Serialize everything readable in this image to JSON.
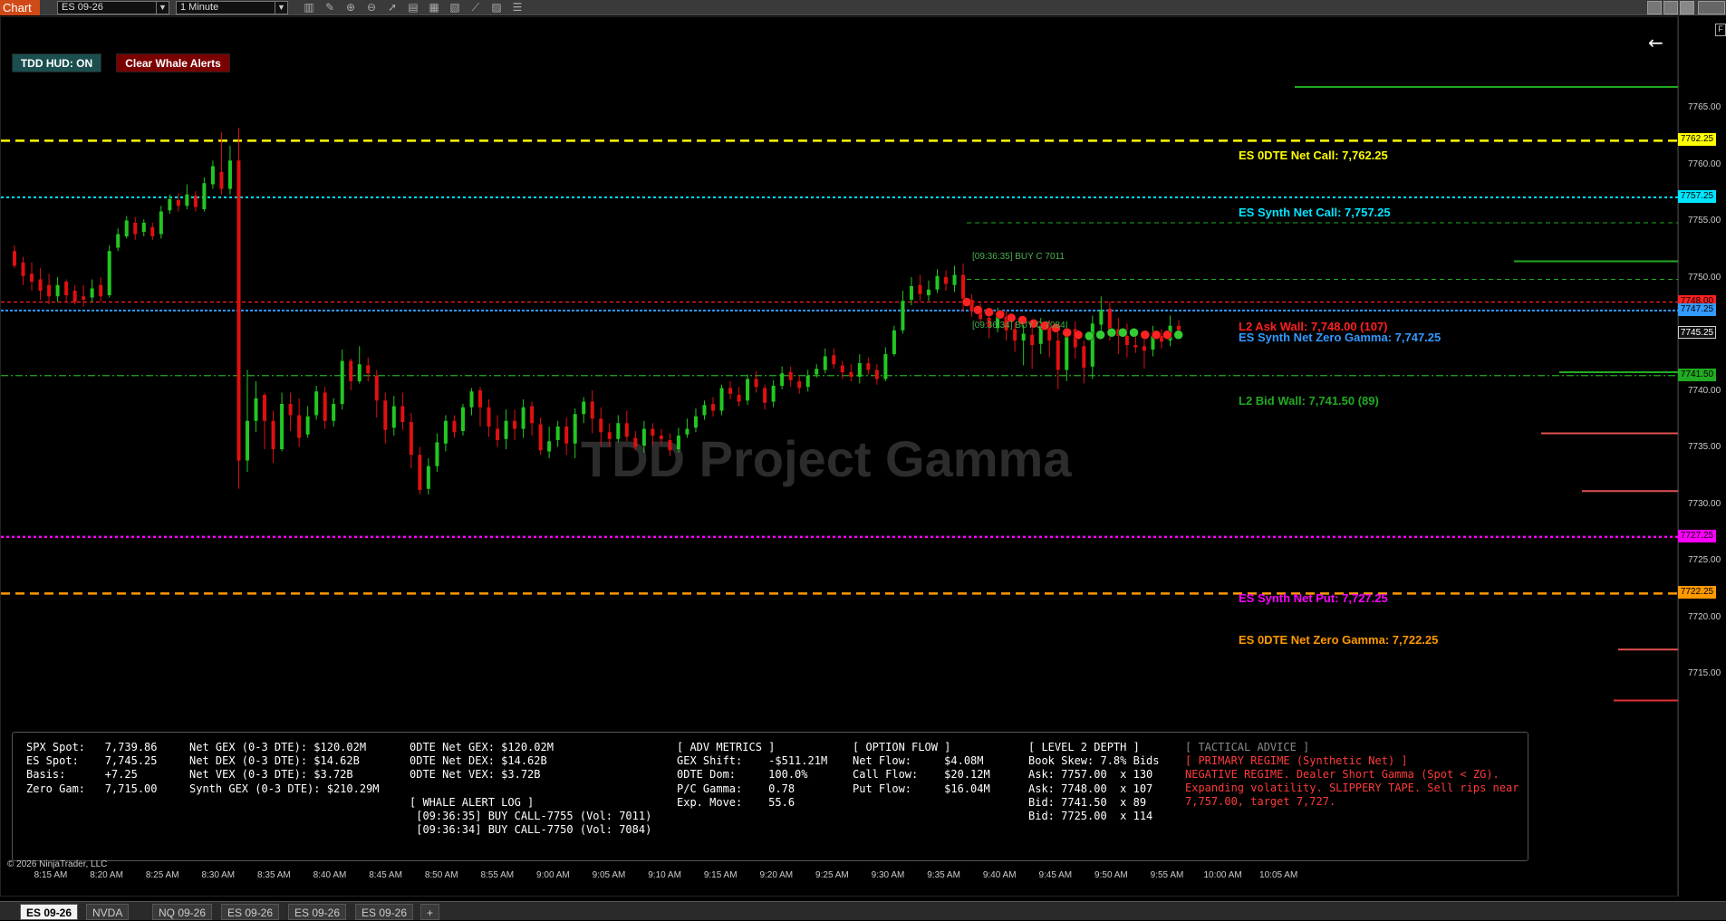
{
  "toolbar": {
    "title": "Chart",
    "instrument": "ES 09-26",
    "interval": "1 Minute",
    "icons": [
      "bar-type-icon",
      "draw-pencil-icon",
      "zoom-in-icon",
      "zoom-out-icon",
      "pointer-icon",
      "templates-icon",
      "data-box-icon",
      "chart-indicators-icon",
      "strategies-icon",
      "properties-icon",
      "chart-list-icon"
    ]
  },
  "buttons": {
    "hud": "TDD HUD: ON",
    "clear": "Clear Whale Alerts"
  },
  "watermark": "TDD Project Gamma",
  "copyright": "© 2026 NinjaTrader, LLC",
  "levels": [
    {
      "label": "ES 0DTE Net Call: 7,762.25",
      "price": 7762.25,
      "color": "#ffff00",
      "price_label": "7762.25"
    },
    {
      "label": "ES Synth Net Call: 7,757.25",
      "price": 7757.25,
      "color": "#00e5ff",
      "price_label": "7757.25"
    },
    {
      "label": "L2 Ask Wall: 7,748.00 (107)",
      "price": 7748.0,
      "color": "#ff2020",
      "price_label": "7748.00"
    },
    {
      "label": "ES Synth Net Zero Gamma: 7,747.25",
      "price": 7747.25,
      "color": "#3399ff",
      "price_label": "7747.25"
    },
    {
      "label": "L2 Bid Wall: 7,741.50 (89)",
      "price": 7741.5,
      "color": "#22aa22",
      "price_label": "7741.50"
    },
    {
      "label": "ES Synth Net Put: 7,727.25",
      "price": 7727.25,
      "color": "#ff00ff",
      "price_label": "7727.25"
    },
    {
      "label": "ES 0DTE Net Zero Gamma: 7,722.25",
      "price": 7722.25,
      "color": "#ff9900",
      "price_label": "7722.25"
    }
  ],
  "last_price_label": "7745.25",
  "trade_tags": [
    "[09:36:35] BUY C 7011",
    "[09:36:34] BUY C 7084"
  ],
  "price_axis": [
    "7765.00",
    "7760.00",
    "7755.00",
    "7750.00",
    "7740.00",
    "7735.00",
    "7730.00",
    "7725.00",
    "7720.00",
    "7715.00"
  ],
  "time_axis": [
    "8:15 AM",
    "8:20 AM",
    "8:25 AM",
    "8:30 AM",
    "8:35 AM",
    "8:40 AM",
    "8:45 AM",
    "8:50 AM",
    "8:55 AM",
    "9:00 AM",
    "9:05 AM",
    "9:10 AM",
    "9:15 AM",
    "9:20 AM",
    "9:25 AM",
    "9:30 AM",
    "9:35 AM",
    "9:40 AM",
    "9:45 AM",
    "9:50 AM",
    "9:55 AM",
    "10:00 AM",
    "10:05 AM"
  ],
  "hud": {
    "col1": "SPX Spot:   7,739.86\nES Spot:    7,745.25\nBasis:      +7.25\nZero Gam:   7,715.00",
    "col2": "Net GEX (0-3 DTE): $120.02M\nNet DEX (0-3 DTE): $14.62B\nNet VEX (0-3 DTE): $3.72B\nSynth GEX (0-3 DTE): $210.29M",
    "col3": "0DTE Net GEX: $120.02M\n0DTE Net DEX: $14.62B\n0DTE Net VEX: $3.72B",
    "whale_title": "[ WHALE ALERT LOG ]",
    "whale_lines": " [09:36:35] BUY CALL-7755 (Vol: 7011)\n [09:36:34] BUY CALL-7750 (Vol: 7084)",
    "col4": "[ ADV METRICS ]\nGEX Shift:    -$511.21M\n0DTE Dom:     100.0%\nP/C Gamma:    0.78\nExp. Move:    55.6",
    "col5": "[ OPTION FLOW ]\nNet Flow:     $4.08M\nCall Flow:    $20.12M\nPut Flow:     $16.04M",
    "col6": "[ LEVEL 2 DEPTH ]\nBook Skew: 7.8% Bids\nAsk: 7757.00  x 130\nAsk: 7748.00  x 107\nBid: 7741.50  x 89\nBid: 7725.00  x 114",
    "tactical_title": "[ TACTICAL ADVICE ]",
    "tactical_regime": "[ PRIMARY REGIME (Synthetic Net) ]",
    "tactical_text": "NEGATIVE REGIME. Dealer Short Gamma (Spot < ZG).\nExpanding volatility. SLIPPERY TAPE. Sell rips near\n7,757.00, target 7,727."
  },
  "tabs": [
    "ES 09-26",
    "NVDA",
    "NQ 09-26",
    "ES 09-26",
    "ES 09-26",
    "ES 09-26",
    "+"
  ],
  "chart_data": {
    "type": "candlestick",
    "price_min": 7712,
    "price_max": 7767,
    "series": [
      [
        7752.5,
        7751.2,
        7753,
        7751
      ],
      [
        7751.5,
        7750.3,
        7752,
        7749.5
      ],
      [
        7750.5,
        7749.8,
        7751.5,
        7749
      ],
      [
        7750,
        7749,
        7751,
        7748.2
      ],
      [
        7749.5,
        7748.5,
        7750.5,
        7747.8
      ],
      [
        7748.5,
        7749.5,
        7750.2,
        7748
      ],
      [
        7749.8,
        7748.6,
        7750,
        7748
      ],
      [
        7749,
        7748,
        7749.5,
        7747.8
      ],
      [
        7748.5,
        7748.2,
        7749.5,
        7747.6
      ],
      [
        7748.4,
        7749.2,
        7750,
        7748
      ],
      [
        7749.5,
        7748.5,
        7750.2,
        7748
      ],
      [
        7748.6,
        7752.5,
        7753,
        7748.4
      ],
      [
        7752.8,
        7754,
        7754.5,
        7752.5
      ],
      [
        7753.8,
        7755.2,
        7755.6,
        7753.6
      ],
      [
        7755,
        7754,
        7755.5,
        7753.5
      ],
      [
        7754.2,
        7755,
        7755.3,
        7753.8
      ],
      [
        7754.6,
        7753.8,
        7755,
        7753.5
      ],
      [
        7754,
        7756,
        7756.5,
        7753.6
      ],
      [
        7756.1,
        7757.1,
        7757.5,
        7755.8
      ],
      [
        7757,
        7756.5,
        7757.6,
        7756
      ],
      [
        7756.5,
        7757.5,
        7758.4,
        7756.2
      ],
      [
        7757.4,
        7756.4,
        7757.8,
        7756
      ],
      [
        7756.2,
        7758.5,
        7759,
        7756
      ],
      [
        7758.4,
        7760,
        7760.5,
        7758
      ],
      [
        7759.5,
        7758,
        7763,
        7757.5
      ],
      [
        7758,
        7760.5,
        7761.8,
        7757.5
      ],
      [
        7760.5,
        7734,
        7763.4,
        7731.5
      ],
      [
        7734,
        7737.5,
        7742,
        7733
      ],
      [
        7737.5,
        7739.5,
        7741,
        7736.5
      ],
      [
        7739.8,
        7737.5,
        7740,
        7735
      ],
      [
        7737.5,
        7735,
        7738.4,
        7733.8
      ],
      [
        7735,
        7739,
        7740,
        7734.8
      ],
      [
        7739,
        7738,
        7740,
        7736.6
      ],
      [
        7738,
        7736,
        7739.5,
        7735.2
      ],
      [
        7736.3,
        7737.9,
        7738.8,
        7736
      ],
      [
        7738,
        7740.1,
        7740.6,
        7737.6
      ],
      [
        7740,
        7737.5,
        7740.5,
        7736.8
      ],
      [
        7737.5,
        7739,
        7739.5,
        7737
      ],
      [
        7739,
        7742.8,
        7743.8,
        7738.5
      ],
      [
        7742.8,
        7741,
        7743,
        7740.2
      ],
      [
        7741,
        7742.5,
        7744.1,
        7740.8
      ],
      [
        7742.4,
        7741.7,
        7743.1,
        7741
      ],
      [
        7741.5,
        7739.3,
        7742,
        7737.8
      ],
      [
        7739.3,
        7736.7,
        7740,
        7735.5
      ],
      [
        7736.9,
        7738.8,
        7739.7,
        7736.2
      ],
      [
        7738.8,
        7737.4,
        7740,
        7736.7
      ],
      [
        7737.4,
        7734.5,
        7738.2,
        7733.3
      ],
      [
        7734.5,
        7731.4,
        7735.2,
        7731
      ],
      [
        7731.5,
        7733.5,
        7734.2,
        7731
      ],
      [
        7733.5,
        7735.6,
        7736.4,
        7733
      ],
      [
        7735.5,
        7737.5,
        7738,
        7734.8
      ],
      [
        7737.5,
        7736.5,
        7738,
        7736
      ],
      [
        7736.6,
        7738.7,
        7739,
        7736.2
      ],
      [
        7738.7,
        7740.1,
        7740.4,
        7738
      ],
      [
        7740.2,
        7738.7,
        7740.5,
        7737
      ],
      [
        7738.7,
        7737,
        7739.4,
        7736.1
      ],
      [
        7736.8,
        7735.8,
        7738,
        7735.2
      ],
      [
        7735.9,
        7737.5,
        7738.5,
        7735
      ],
      [
        7737.5,
        7736.8,
        7738.5,
        7735.8
      ],
      [
        7736.8,
        7738.7,
        7739.4,
        7736
      ],
      [
        7738.8,
        7737.3,
        7739.2,
        7736.2
      ],
      [
        7737.2,
        7734.9,
        7737.8,
        7734.5
      ],
      [
        7734.8,
        7735.7,
        7737,
        7734.2
      ],
      [
        7735.8,
        7737,
        7737.5,
        7735.2
      ],
      [
        7737,
        7735.5,
        7737.8,
        7734.5
      ],
      [
        7735.5,
        7738.1,
        7738.6,
        7734.2
      ],
      [
        7738.1,
        7739.2,
        7739.6,
        7737.3
      ],
      [
        7739.2,
        7737.7,
        7740.2,
        7736.4
      ],
      [
        7737.7,
        7736.5,
        7738.7,
        7735.3
      ],
      [
        7736.5,
        7735.9,
        7737.3,
        7735.2
      ],
      [
        7735.9,
        7737.3,
        7738,
        7735.6
      ],
      [
        7737.3,
        7736.1,
        7738.4,
        7735.7
      ],
      [
        7736,
        7735.2,
        7736.6,
        7734.9
      ],
      [
        7735.3,
        7736.8,
        7737.5,
        7734.7
      ],
      [
        7736.8,
        7736.2,
        7737.3,
        7735.3
      ],
      [
        7736.2,
        7735.9,
        7736.8,
        7735.4
      ],
      [
        7735.8,
        7734.9,
        7736.4,
        7734.4
      ],
      [
        7735,
        7736.2,
        7736.9,
        7734.7
      ],
      [
        7736.3,
        7736.8,
        7737.7,
        7736
      ],
      [
        7736.9,
        7737.9,
        7738.6,
        7736.5
      ],
      [
        7738,
        7738.9,
        7739.3,
        7737.6
      ],
      [
        7739,
        7738.4,
        7739.6,
        7737.9
      ],
      [
        7738.4,
        7740.4,
        7740.7,
        7738
      ],
      [
        7740.4,
        7739.9,
        7741,
        7739.4
      ],
      [
        7739.8,
        7739.2,
        7740.5,
        7738.8
      ],
      [
        7739.3,
        7741.2,
        7741.6,
        7738.9
      ],
      [
        7741.2,
        7740.5,
        7741.9,
        7740
      ],
      [
        7740.4,
        7739.1,
        7740.7,
        7738.5
      ],
      [
        7739.2,
        7740.6,
        7741.1,
        7738.7
      ],
      [
        7740.6,
        7741.7,
        7742.3,
        7740.3
      ],
      [
        7741.8,
        7741.1,
        7742.3,
        7740.5
      ],
      [
        7741,
        7740.4,
        7741.5,
        7739.9
      ],
      [
        7740.5,
        7741.5,
        7742,
        7740.1
      ],
      [
        7741.6,
        7742.1,
        7742.5,
        7741.3
      ],
      [
        7742,
        7743.2,
        7743.9,
        7741.7
      ],
      [
        7743.3,
        7742.5,
        7743.9,
        7742.1
      ],
      [
        7742.4,
        7741.8,
        7742.8,
        7741.2
      ],
      [
        7741.8,
        7741.4,
        7742.5,
        7741
      ],
      [
        7741.4,
        7742.6,
        7743.4,
        7740.8
      ],
      [
        7742.6,
        7742,
        7743.1,
        7741.6
      ],
      [
        7742,
        7741.2,
        7742.5,
        7740.7
      ],
      [
        7741.2,
        7743.4,
        7744,
        7741
      ],
      [
        7743.4,
        7745.5,
        7745.9,
        7743.2
      ],
      [
        7745.5,
        7748.1,
        7749,
        7745.2
      ],
      [
        7748.2,
        7749.4,
        7750.2,
        7747.7
      ],
      [
        7749.5,
        7748.7,
        7750.4,
        7748.1
      ],
      [
        7748.6,
        7749.1,
        7749.9,
        7748.1
      ],
      [
        7749.1,
        7750.3,
        7750.9,
        7748.8
      ],
      [
        7750.2,
        7749.6,
        7750.8,
        7749
      ],
      [
        7749.5,
        7750.4,
        7751.2,
        7748.9
      ],
      [
        7750.4,
        7748.3,
        7751.4,
        7747.2
      ],
      [
        7748.2,
        7747.2,
        7748.7,
        7746.7
      ],
      [
        7747.3,
        7746.5,
        7747.9,
        7746.2
      ],
      [
        7746.6,
        7745.8,
        7747.3,
        7744.8
      ],
      [
        7745.7,
        7746.7,
        7747.5,
        7745.3
      ],
      [
        7746.7,
        7745.5,
        7747.2,
        7744.6
      ],
      [
        7745.6,
        7744.6,
        7746.2,
        7743.6
      ],
      [
        7744.6,
        7745.2,
        7746.3,
        7742.4
      ],
      [
        7745.1,
        7744.2,
        7745.9,
        7742.1
      ],
      [
        7744.3,
        7745.9,
        7746.6,
        7743.4
      ],
      [
        7745.8,
        7744.6,
        7746.4,
        7743.1
      ],
      [
        7744.6,
        7742,
        7745.8,
        7740.3
      ],
      [
        7742,
        7745.7,
        7746.3,
        7741
      ],
      [
        7745.6,
        7744,
        7746.3,
        7743
      ],
      [
        7744.1,
        7742.2,
        7744.6,
        7740.8
      ],
      [
        7742.3,
        7746.1,
        7746.8,
        7741.2
      ],
      [
        7746,
        7747.3,
        7748.5,
        7745.1
      ],
      [
        7747.4,
        7745.5,
        7748,
        7744.6
      ],
      [
        7745.6,
        7745,
        7746.6,
        7743.4
      ],
      [
        7745,
        7744.2,
        7746.1,
        7743.1
      ],
      [
        7744.2,
        7744,
        7745,
        7743.5
      ],
      [
        7744.1,
        7743.7,
        7745.3,
        7742.1
      ],
      [
        7743.8,
        7745,
        7745.9,
        7743.2
      ],
      [
        7745,
        7744.5,
        7745.6,
        7743.9
      ],
      [
        7744.6,
        7745.9,
        7746.8,
        7744.1
      ],
      [
        7745.9,
        7745.2,
        7746.4,
        7744.8
      ]
    ],
    "bubble_prices": [
      7748.0,
      7747.3,
      7747.1,
      7746.9,
      7746.6,
      7746.4,
      7746.1,
      7745.9,
      7745.7,
      7745.3,
      7745.1,
      7745.0,
      7745.1,
      7745.3,
      7745.3,
      7745.3,
      7745.1,
      7745.1,
      7745.1,
      7745.1
    ],
    "bubble_colors": [
      "red",
      "red",
      "red",
      "red",
      "red",
      "red",
      "red",
      "red",
      "red",
      "red",
      "red",
      "green",
      "green",
      "green",
      "green",
      "green",
      "red",
      "red",
      "red",
      "green"
    ]
  }
}
